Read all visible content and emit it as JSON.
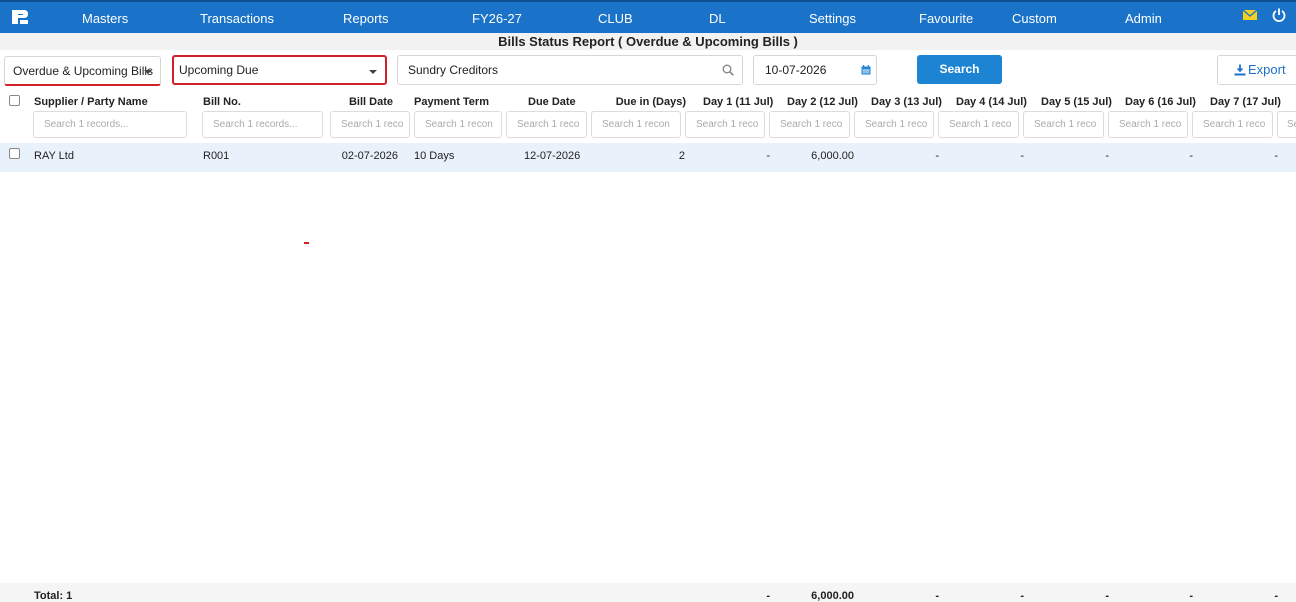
{
  "nav": {
    "items": [
      "Masters",
      "Transactions",
      "Reports",
      "FY26-27",
      "CLUB",
      "DL",
      "Settings",
      "Favourite",
      "Custom",
      "Admin"
    ]
  },
  "report_title": "Bills Status Report ( Overdue & Upcoming Bills )",
  "filters": {
    "bill_type": "Overdue & Upcoming Bills",
    "due_type": "Upcoming Due",
    "party_group": "Sundry Creditors",
    "date": "10-07-2026",
    "search_label": "Search",
    "export_label": "Export"
  },
  "table": {
    "columns": [
      "Supplier / Party Name",
      "Bill No.",
      "Bill Date",
      "Payment Term",
      "Due Date",
      "Due in (Days)",
      "Day 1 (11 Jul)",
      "Day 2 (12 Jul)",
      "Day 3 (13 Jul)",
      "Day 4 (14 Jul)",
      "Day 5 (15 Jul)",
      "Day 6 (16 Jul)",
      "Day 7 (17 Jul)"
    ],
    "filter_placeholders": [
      "Search 1 records...",
      "Search 1 records...",
      "Search 1 reco",
      "Search 1 recon",
      "Search 1 reco",
      "Search 1 recon",
      "Search 1 reco",
      "Search 1 reco",
      "Search 1 reco",
      "Search 1 reco",
      "Search 1 reco",
      "Search 1 reco",
      "Search 1 reco",
      "Se"
    ],
    "rows": [
      [
        "RAY Ltd",
        "R001",
        "02-07-2026",
        "10 Days",
        "12-07-2026",
        "2",
        "-",
        "6,000.00",
        "-",
        "-",
        "-",
        "-",
        "-"
      ]
    ],
    "footer": [
      "Total: 1",
      "-",
      "6,000.00",
      "-",
      "-",
      "-",
      "-",
      "-"
    ]
  },
  "colors": {
    "nav_bg": "#1a73c8",
    "accent_red": "#d0202a",
    "row_highlight": "#e9f1fb",
    "button_blue": "#1d84d4"
  },
  "icons": [
    "logo-icon",
    "mail-icon",
    "power-icon",
    "caret-down-icon",
    "search-icon",
    "calendar-icon",
    "download-icon",
    "checkbox-icon"
  ]
}
